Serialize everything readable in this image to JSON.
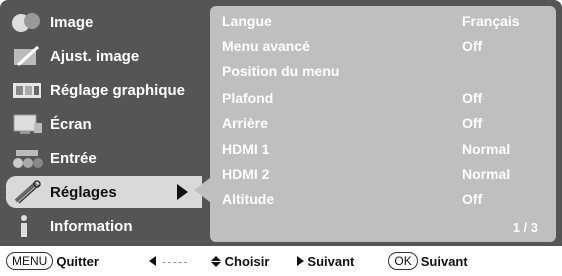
{
  "sidebar": {
    "items": [
      {
        "label": "Image",
        "icon": "image-icon"
      },
      {
        "label": "Ajust. image",
        "icon": "image-adjust-icon"
      },
      {
        "label": "Réglage graphique",
        "icon": "graphic-settings-icon"
      },
      {
        "label": "Écran",
        "icon": "screen-icon"
      },
      {
        "label": "Entrée",
        "icon": "input-icon"
      },
      {
        "label": "Réglages",
        "icon": "settings-wrench-icon",
        "active": true
      },
      {
        "label": "Information",
        "icon": "information-icon"
      }
    ]
  },
  "panel": {
    "rows": [
      {
        "label": "Langue",
        "value": "Français"
      },
      {
        "label": "Menu avancé",
        "value": "Off"
      },
      {
        "label": "Position du menu",
        "value": ""
      },
      {
        "label": "Plafond",
        "value": "Off"
      },
      {
        "label": "Arrière",
        "value": "Off"
      },
      {
        "label": "HDMI 1",
        "value": "Normal"
      },
      {
        "label": "HDMI 2",
        "value": "Normal"
      },
      {
        "label": "Altitude",
        "value": "Off"
      }
    ],
    "page": "1 / 3"
  },
  "footer": {
    "menu_badge": "MENU",
    "quit": "Quitter",
    "back_dashes": "-----",
    "choose": "Choisir",
    "next": "Suivant",
    "ok_badge": "OK",
    "ok_next": "Suivant"
  },
  "colors": {
    "frame": "#555555",
    "panel": "#bfbfbf",
    "active_item": "#d9d9d9",
    "text": "#ffffff"
  }
}
